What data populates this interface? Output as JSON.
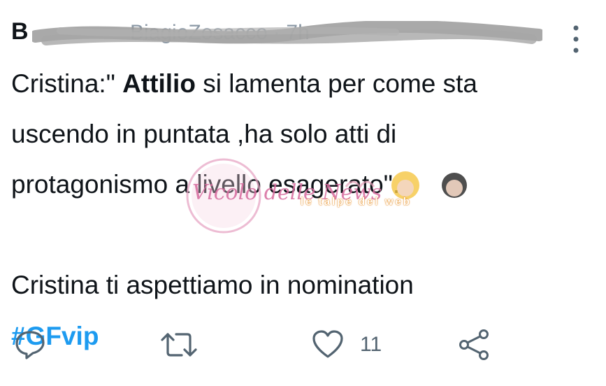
{
  "tweet": {
    "author_initial": "B",
    "handle_fragment": "BiagioZosacco · 7h",
    "text_lines": [
      [
        {
          "text": "Cristina:\" "
        },
        {
          "text": "Attilio",
          "bold": true
        },
        {
          "text": " si lamenta per come sta"
        }
      ],
      [
        {
          "text": "uscendo in puntata ,ha solo atti di"
        }
      ],
      [
        {
          "text": "protagonismo a livello esagerato\"."
        }
      ]
    ],
    "line_4": "Cristina ti aspettiamo in nomination",
    "hashtag": "#GFvip"
  },
  "watermark": {
    "logo_text": "Vicolo delle News",
    "tagline": "le talpe del web"
  },
  "actions": {
    "reply_icon": "reply-icon",
    "retweet_icon": "retweet-icon",
    "like_icon": "heart-icon",
    "like_count": "11",
    "share_icon": "share-icon"
  },
  "colors": {
    "text": "#0f1419",
    "hashtag": "#1d9bf0",
    "muted": "#536471"
  }
}
